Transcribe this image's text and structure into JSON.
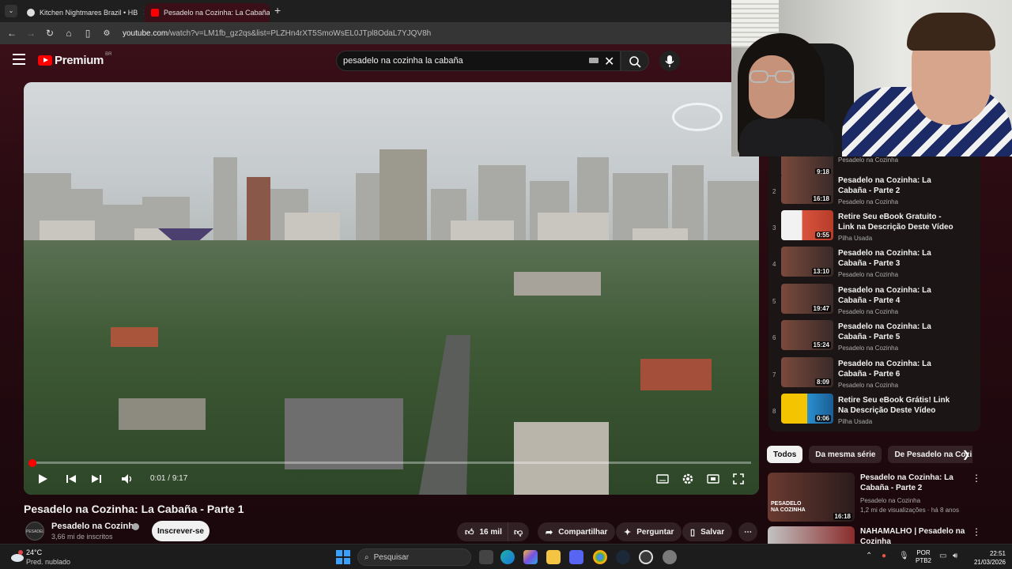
{
  "browser": {
    "tabs": [
      {
        "title": "Kitchen Nightmares Brazil • HB",
        "active": false
      },
      {
        "title": "Pesadelo na Cozinha: La Cabaña",
        "active": true
      }
    ],
    "new_tab": "+",
    "url_host": "youtube.com",
    "url_path": "/watch?v=LM1fb_gz2qs&list=PLZHn4rXT5SmoWsEL0JTpl8OdaL7YJQV8h"
  },
  "masthead": {
    "logo_text": "Premium",
    "logo_region": "BR",
    "search_value": "pesadelo na cozinha la cabaña"
  },
  "player": {
    "time_current": "0:01",
    "time_total": "9:17",
    "progress": 0.002
  },
  "video": {
    "title": "Pesadelo na Cozinha: La Cabaña - Parte 1",
    "channel": "Pesadelo na Cozinha",
    "channel_avatar": "PESADELO NA COZINHA",
    "subs": "3,66 mi de inscritos",
    "subscribe": "Inscrever-se",
    "likes": "16 mil",
    "share": "Compartilhar",
    "ask": "Perguntar",
    "save": "Salvar"
  },
  "playlist": {
    "items": [
      {
        "idx": "",
        "dur": "9:18",
        "title": "",
        "channel": "Pesadelo na Cozinha",
        "kind": "show"
      },
      {
        "idx": "2",
        "dur": "16:18",
        "title": "Pesadelo na Cozinha: La Cabaña - Parte 2",
        "channel": "Pesadelo na Cozinha",
        "kind": "show"
      },
      {
        "idx": "3",
        "dur": "0:55",
        "title": "Retire Seu eBook Gratuito - Link na Descrição Deste Vídeo",
        "channel": "Pilha Usada",
        "kind": "ebook"
      },
      {
        "idx": "4",
        "dur": "13:10",
        "title": "Pesadelo na Cozinha: La Cabaña - Parte 3",
        "channel": "Pesadelo na Cozinha",
        "kind": "show"
      },
      {
        "idx": "5",
        "dur": "19:47",
        "title": "Pesadelo na Cozinha: La Cabaña - Parte 4",
        "channel": "Pesadelo na Cozinha",
        "kind": "show"
      },
      {
        "idx": "6",
        "dur": "15:24",
        "title": "Pesadelo na Cozinha: La Cabaña - Parte 5",
        "channel": "Pesadelo na Cozinha",
        "kind": "show"
      },
      {
        "idx": "7",
        "dur": "8:09",
        "title": "Pesadelo na Cozinha: La Cabaña - Parte 6",
        "channel": "Pesadelo na Cozinha",
        "kind": "show"
      },
      {
        "idx": "8",
        "dur": "0:06",
        "title": "Retire Seu eBook Grátis! Link Na Descrição Deste Vídeo",
        "channel": "Pilha Usada",
        "kind": "ebook2"
      }
    ]
  },
  "chips": [
    "Todos",
    "Da mesma série",
    "De Pesadelo na Cozinha"
  ],
  "recs": [
    {
      "title": "Pesadelo na Cozinha: La Cabaña - Parte 2",
      "channel": "Pesadelo na Cozinha",
      "meta": "1,2 mi de visualizações · há 8 anos",
      "dur": "16:18",
      "thumb_text": "PESADELO NA COZINHA"
    },
    {
      "title": "NAHAMALHO | Pesadelo na Cozinha [REAPRESENTAÇÃO]",
      "channel": "",
      "meta": "",
      "dur": "",
      "thumb_text": ""
    }
  ],
  "taskbar": {
    "temp": "24°C",
    "weather": "Pred. nublado",
    "search": "Pesquisar",
    "lang1": "POR",
    "lang2": "PTB2",
    "time": "22:51",
    "date": "21/03/2026"
  },
  "colors": {
    "accent": "#ff0000",
    "page_bg": "#2a0b12"
  }
}
